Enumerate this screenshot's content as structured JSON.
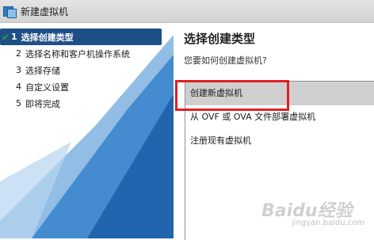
{
  "window": {
    "title": "新建虚拟机"
  },
  "steps": [
    {
      "num": "1",
      "label": "选择创建类型"
    },
    {
      "num": "2",
      "label": "选择名称和客户机操作系统"
    },
    {
      "num": "3",
      "label": "选择存储"
    },
    {
      "num": "4",
      "label": "自定义设置"
    },
    {
      "num": "5",
      "label": "即将完成"
    }
  ],
  "active_step": 1,
  "main": {
    "heading": "选择创建类型",
    "subheading": "您要如何创建虚拟机?",
    "options": [
      "创建新虚拟机",
      "从 OVF 或 OVA 文件部署虚拟机",
      "注册现有虚拟机"
    ],
    "selected_index": 0
  },
  "watermark": {
    "text": "Baidu经验",
    "sub": "jingyan.baidu.com"
  },
  "colors": {
    "active_step_bg": "#1e4f86",
    "highlight_border": "#e02020",
    "check": "#2fa32f"
  }
}
